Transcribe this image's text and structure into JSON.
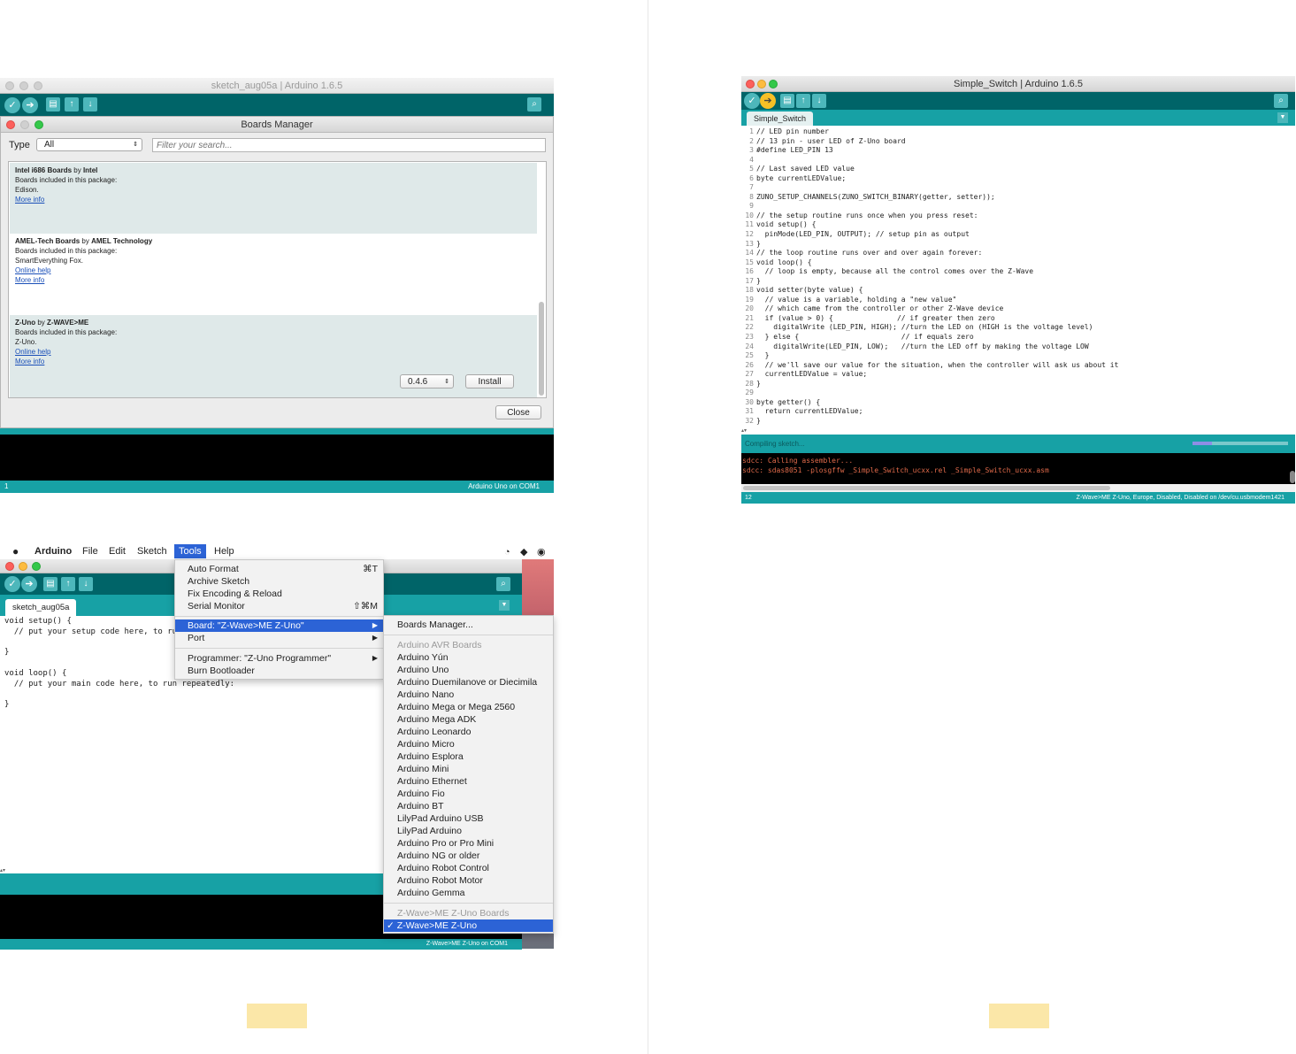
{
  "win1": {
    "title": "sketch_aug05a | Arduino 1.6.5",
    "boards_manager": {
      "title": "Boards Manager",
      "type_label": "Type",
      "type_value": "All",
      "search_placeholder": "Filter your search...",
      "entries": [
        {
          "name": "Intel i686 Boards",
          "by": " by ",
          "vendor": "Intel",
          "included_label": "Boards included in this package:",
          "boards": "Edison.",
          "links": [
            "More info"
          ]
        },
        {
          "name": "AMEL-Tech Boards",
          "by": " by ",
          "vendor": "AMEL Technology",
          "included_label": "Boards included in this package:",
          "boards": "SmartEverything Fox.",
          "links": [
            "Online help",
            "More info"
          ]
        },
        {
          "name": "Z-Uno",
          "by": " by ",
          "vendor": "Z-WAVE>ME",
          "included_label": "Boards included in this package:",
          "boards": "Z-Uno.",
          "links": [
            "Online help",
            "More info"
          ]
        }
      ],
      "version_value": "0.4.6",
      "install_label": "Install",
      "close_label": "Close"
    },
    "status_left": "1",
    "status_right": "Arduino Uno on COM1"
  },
  "win2": {
    "title": "Simple_Switch | Arduino 1.6.5",
    "tab": "Simple_Switch",
    "code_lines": [
      "// LED pin number",
      "// 13 pin - user LED of Z-Uno board",
      "#define LED_PIN 13",
      "",
      "// Last saved LED value",
      "byte currentLEDValue;",
      "",
      "ZUNO_SETUP_CHANNELS(ZUNO_SWITCH_BINARY(getter, setter));",
      "",
      "// the setup routine runs once when you press reset:",
      "void setup() {",
      "  pinMode(LED_PIN, OUTPUT); // setup pin as output",
      "}",
      "// the loop routine runs over and over again forever:",
      "void loop() {",
      "  // loop is empty, because all the control comes over the Z-Wave",
      "}",
      "void setter(byte value) {",
      "  // value is a variable, holding a \"new value\"",
      "  // which came from the controller or other Z-Wave device",
      "  if (value > 0) {               // if greater then zero",
      "    digitalWrite (LED_PIN, HIGH); //turn the LED on (HIGH is the voltage level)",
      "  } else {                        // if equals zero",
      "    digitalWrite(LED_PIN, LOW);   //turn the LED off by making the voltage LOW",
      "  }",
      "  // we'll save our value for the situation, when the controller will ask us about it",
      "  currentLEDValue = value;",
      "}",
      "",
      "byte getter() {",
      "  return currentLEDValue;",
      "}"
    ],
    "compile_status": "Compiling sketch...",
    "console_lines": [
      "sdcc: Calling assembler...",
      "sdcc: sdas8051 -plosgffw _Simple_Switch_ucxx.rel _Simple_Switch_ucxx.asm"
    ],
    "status_left": "12",
    "status_right": "Z-Wave>ME Z-Uno, Europe, Disabled, Disabled on /dev/cu.usbmodem1421"
  },
  "win3": {
    "menubar": {
      "apple": "",
      "items": [
        "Arduino",
        "File",
        "Edit",
        "Sketch",
        "Tools",
        "Help"
      ]
    },
    "tab": "sketch_aug05a",
    "code_lines": [
      "void setup() {",
      "  // put your setup code here, to run once:",
      "",
      "}",
      "",
      "void loop() {",
      "  // put your main code here, to run repeatedly:",
      "",
      "}"
    ],
    "tools_menu": {
      "items": [
        {
          "label": "Auto Format",
          "shortcut": "⌘T"
        },
        {
          "label": "Archive Sketch",
          "shortcut": ""
        },
        {
          "label": "Fix Encoding & Reload",
          "shortcut": ""
        },
        {
          "label": "Serial Monitor",
          "shortcut": "⇧⌘M"
        },
        {
          "label": "Board: \"Z-Wave>ME Z-Uno\"",
          "shortcut": ""
        },
        {
          "label": "Port",
          "shortcut": ""
        },
        {
          "label": "Programmer: \"Z-Uno Programmer\"",
          "shortcut": ""
        },
        {
          "label": "Burn Bootloader",
          "shortcut": ""
        }
      ]
    },
    "board_menu": {
      "manager": "Boards Manager...",
      "avr_header": "Arduino AVR Boards",
      "avr_boards": [
        "Arduino Yún",
        "Arduino Uno",
        "Arduino Duemilanove or Diecimila",
        "Arduino Nano",
        "Arduino Mega or Mega 2560",
        "Arduino Mega ADK",
        "Arduino Leonardo",
        "Arduino Micro",
        "Arduino Esplora",
        "Arduino Mini",
        "Arduino Ethernet",
        "Arduino Fio",
        "Arduino BT",
        "LilyPad Arduino USB",
        "LilyPad Arduino",
        "Arduino Pro or Pro Mini",
        "Arduino NG or older",
        "Arduino Robot Control",
        "Arduino Robot Motor",
        "Arduino Gemma"
      ],
      "zuno_header": "Z-Wave>ME Z-Uno Boards",
      "zuno_selected": "✓ Z-Wave>ME Z-Uno"
    },
    "status_right": "Z-Wave>ME Z-Uno on COM1"
  },
  "colors": {
    "toolbar": "#006468",
    "teal": "#17a1a5",
    "highlight": "#2c63d6",
    "page_mark": "#fbe7a8"
  }
}
